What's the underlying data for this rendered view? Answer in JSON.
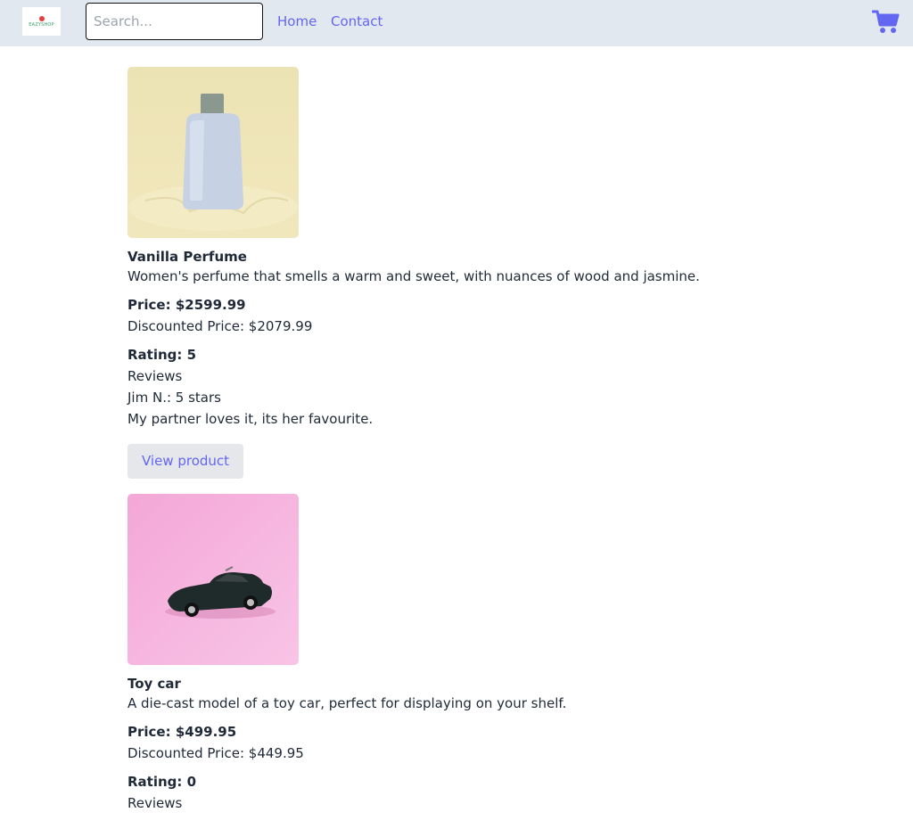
{
  "header": {
    "logo_text": "EAZYSHOP",
    "search_placeholder": "Search...",
    "search_value": "",
    "nav": [
      {
        "label": "Home"
      },
      {
        "label": "Contact"
      }
    ],
    "cart_icon": "cart-icon"
  },
  "colors": {
    "header_bg": "#e2e8f0",
    "accent": "#6366f1",
    "button_bg": "#e5e7eb",
    "text": "#1f2937"
  },
  "products": [
    {
      "image": "perfume-bottle-image",
      "name": "Vanilla Perfume",
      "description": "Women's perfume that smells a warm and sweet, with nuances of wood and jasmine.",
      "price": "Price: $2599.99",
      "discounted_price": "Discounted Price: $2079.99",
      "rating": "Rating: 5",
      "reviews_label": "Reviews",
      "review_author": "Jim N.: 5 stars",
      "review_text": "My partner loves it, its her favourite.",
      "button_label": "View product"
    },
    {
      "image": "toy-car-image",
      "name": "Toy car",
      "description": "A die-cast model of a toy car, perfect for displaying on your shelf.",
      "price": "Price: $499.95",
      "discounted_price": "Discounted Price: $449.95",
      "rating": "Rating: 0",
      "reviews_label": "Reviews"
    }
  ]
}
